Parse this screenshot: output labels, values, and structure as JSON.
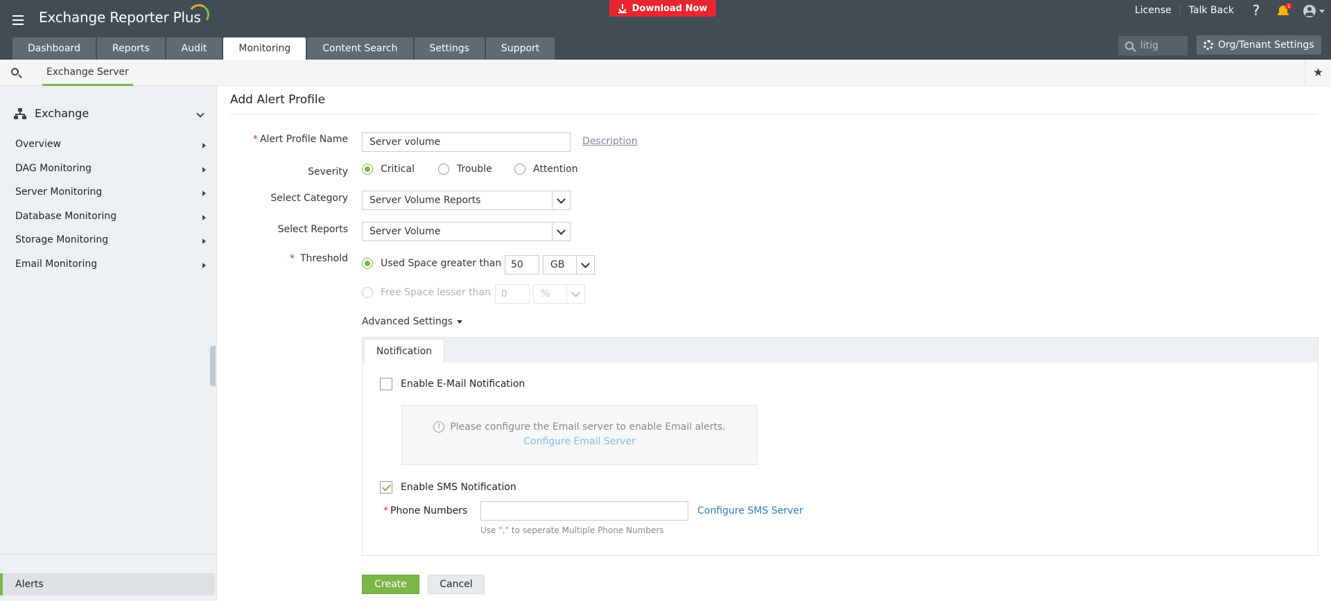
{
  "header": {
    "app_name": "Exchange Reporter Plus",
    "download_label": "Download Now",
    "links": [
      "License",
      "Talk Back"
    ],
    "help_glyph": "?",
    "notification_count": "1",
    "search_value": "litig",
    "org_settings_label": "Org/Tenant Settings",
    "accent_download": "#e8262f"
  },
  "nav": {
    "tabs": [
      "Dashboard",
      "Reports",
      "Audit",
      "Monitoring",
      "Content Search",
      "Settings",
      "Support"
    ],
    "active_tab": "Monitoring"
  },
  "subnav": {
    "tab_label": "Exchange Server",
    "star_icon": "star-icon"
  },
  "sidebar": {
    "section_title": "Exchange",
    "items": [
      {
        "label": "Overview"
      },
      {
        "label": "DAG Monitoring"
      },
      {
        "label": "Server Monitoring"
      },
      {
        "label": "Database Monitoring"
      },
      {
        "label": "Storage Monitoring"
      },
      {
        "label": "Email Monitoring"
      }
    ],
    "bottom_item": "Alerts",
    "accent": "#7ab648"
  },
  "form": {
    "title": "Add Alert Profile",
    "profile_name": {
      "label": "Alert Profile Name",
      "value": "Server volume",
      "description_link": "Description"
    },
    "severity": {
      "label": "Severity",
      "options": [
        "Critical",
        "Trouble",
        "Attention"
      ],
      "selected": "Critical"
    },
    "category": {
      "label": "Select Category",
      "value": "Server Volume Reports"
    },
    "reports": {
      "label": "Select Reports",
      "value": "Server Volume"
    },
    "threshold": {
      "label": "Threshold",
      "used_label": "Used Space greater than",
      "used_value": "50",
      "used_unit": "GB",
      "free_label": "Free Space lesser than",
      "free_value": "0",
      "free_unit": "%"
    },
    "advanced_label": "Advanced Settings",
    "notification": {
      "tab_label": "Notification",
      "email_label": "Enable E-Mail Notification",
      "email_checked": false,
      "email_info": "Please configure the Email server to enable Email alerts.",
      "email_config_link": "Configure Email Server",
      "sms_label": "Enable SMS Notification",
      "sms_checked": true,
      "phone_label": "Phone Numbers",
      "phone_value": "",
      "sms_config_link": "Configure SMS Server",
      "phone_hint": "Use \",\" to seperate Multiple Phone Numbers"
    },
    "buttons": {
      "create": "Create",
      "cancel": "Cancel"
    }
  }
}
